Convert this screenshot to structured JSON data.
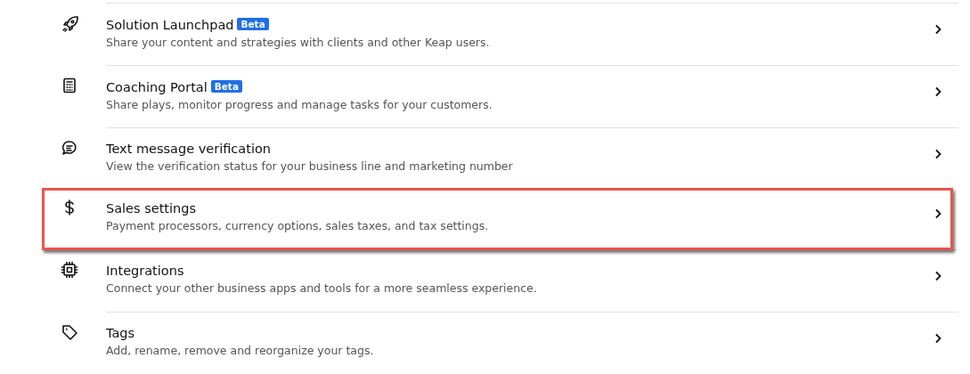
{
  "settings": [
    {
      "title": "Solution Launchpad",
      "badge": "Beta",
      "description": "Share your content and strategies with clients and other Keap users.",
      "highlighted": false
    },
    {
      "title": "Coaching Portal",
      "badge": "Beta",
      "description": "Share plays, monitor progress and manage tasks for your customers.",
      "highlighted": false
    },
    {
      "title": "Text message verification",
      "description": "View the verification status for your business line and marketing number",
      "highlighted": false
    },
    {
      "title": "Sales settings",
      "description": "Payment processors, currency options, sales taxes, and tax settings.",
      "highlighted": true
    },
    {
      "title": "Integrations",
      "description": "Connect your other business apps and tools for a more seamless experience.",
      "highlighted": false
    },
    {
      "title": "Tags",
      "description": "Add, rename, remove and reorganize your tags.",
      "highlighted": false
    }
  ]
}
